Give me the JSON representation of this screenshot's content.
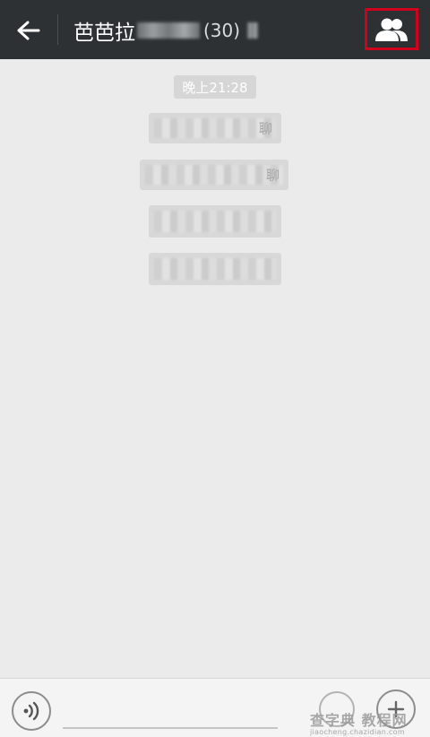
{
  "header": {
    "title_visible": "芭芭拉",
    "member_count": "(30)",
    "back_icon": "arrow-left-icon",
    "members_icon": "group-members-icon",
    "highlight_color": "#d0021b",
    "bar_color": "#2d3133"
  },
  "chat": {
    "timestamp": "晚上21:28",
    "messages": [
      {
        "visible_tail": "聊"
      },
      {
        "visible_tail": "聊"
      },
      {
        "visible_tail": ""
      },
      {
        "visible_tail": ""
      }
    ]
  },
  "footer": {
    "voice_icon": "voice-input-icon",
    "emoji_icon": "emoji-icon",
    "more_icon": "plus-icon"
  },
  "watermark": {
    "brand": "查字典 教程网",
    "url": "jiaocheng.chazidian.com"
  }
}
